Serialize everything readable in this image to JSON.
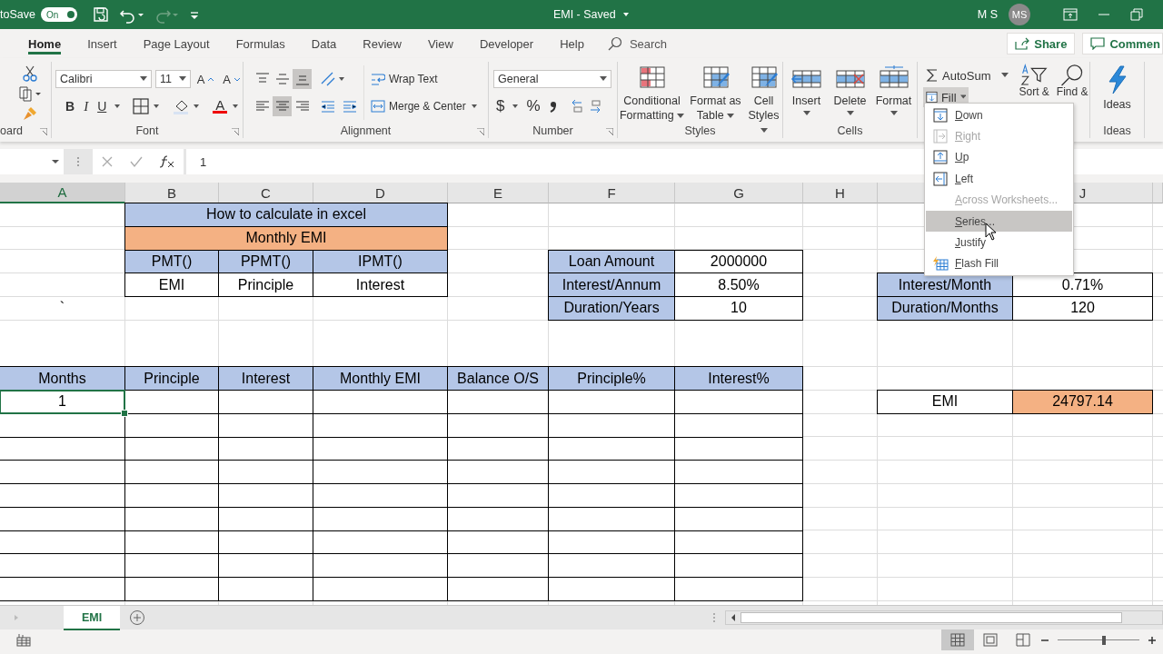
{
  "title_bar": {
    "autosave_label": "toSave",
    "autosave_toggle": {
      "label": "On",
      "on": true
    },
    "document_title": "EMI  -  Saved",
    "user_name": "M S",
    "avatar_initials": "MS"
  },
  "tabs": [
    {
      "label": "Home",
      "selected": true
    },
    {
      "label": "Insert",
      "selected": false
    },
    {
      "label": "Page Layout",
      "selected": false
    },
    {
      "label": "Formulas",
      "selected": false
    },
    {
      "label": "Data",
      "selected": false
    },
    {
      "label": "Review",
      "selected": false
    },
    {
      "label": "View",
      "selected": false
    },
    {
      "label": "Developer",
      "selected": false
    },
    {
      "label": "Help",
      "selected": false
    }
  ],
  "search": {
    "placeholder": "Search"
  },
  "share_button": "Share",
  "comments_button": "Commen",
  "ribbon": {
    "clipboard": {
      "label": "oard"
    },
    "font": {
      "font_name": "Calibri",
      "font_size": "11",
      "grow_glyph": "A",
      "shrink_glyph": "A",
      "bold": "B",
      "italic": "I",
      "underline": "U",
      "color_glyph": "A",
      "label": "Font"
    },
    "alignment": {
      "vertical_buttons": [
        {
          "kind": "top",
          "selected": false
        },
        {
          "kind": "middle",
          "selected": false
        },
        {
          "kind": "bottom",
          "selected": true
        }
      ],
      "horizontal_buttons": [
        {
          "kind": "left",
          "selected": false
        },
        {
          "kind": "center",
          "selected": true
        },
        {
          "kind": "right",
          "selected": false
        }
      ],
      "wrap_text": "Wrap Text",
      "merge_center": "Merge & Center",
      "label": "Alignment"
    },
    "number": {
      "format": "General",
      "currency": "$",
      "percent": "%",
      "label": "Number"
    },
    "styles": {
      "buttons": [
        {
          "kind": "conditional",
          "label": "Conditional Formatting"
        },
        {
          "kind": "table",
          "label": "Format as Table"
        },
        {
          "kind": "cellstyles",
          "label": "Cell Styles"
        }
      ],
      "label": "Styles"
    },
    "cells": {
      "buttons": [
        {
          "kind": "insert",
          "label": "Insert"
        },
        {
          "kind": "delete",
          "label": "Delete"
        },
        {
          "kind": "format",
          "label": "Format"
        }
      ],
      "label": "Cells"
    },
    "editing": {
      "autosum": "AutoSum",
      "fill": "Fill",
      "sort": "Sort &",
      "find": "Find &"
    },
    "ideas": {
      "button": "Ideas",
      "label": "Ideas"
    }
  },
  "formula_bar": {
    "value": "1"
  },
  "sheet": {
    "columns": [
      {
        "label": "A",
        "selected": true
      },
      {
        "label": "B",
        "selected": false
      },
      {
        "label": "C",
        "selected": false
      },
      {
        "label": "D",
        "selected": false
      },
      {
        "label": "E",
        "selected": false
      },
      {
        "label": "F",
        "selected": false
      },
      {
        "label": "G",
        "selected": false
      },
      {
        "label": "H",
        "selected": false
      },
      {
        "selected": false
      },
      {
        "label": "J",
        "selected": false
      }
    ],
    "rows": [
      [
        {},
        {
          "text": "How to calculate in excel",
          "color": "#b4c6e7",
          "bordered": true
        },
        {
          "merged": true
        },
        {
          "merged": true
        }
      ],
      [
        {},
        {
          "text": "Monthly EMI",
          "color": "#f4b183",
          "bordered": true
        },
        {
          "merged": true
        },
        {
          "merged": true
        }
      ],
      [
        {},
        {
          "text": "PMT()",
          "color": "#b4c6e7",
          "bordered": true
        },
        {
          "text": "PPMT()",
          "color": "#b4c6e7",
          "bordered": true
        },
        {
          "text": "IPMT()",
          "color": "#b4c6e7",
          "bordered": true
        },
        {},
        {
          "text": "Loan Amount",
          "color": "#b4c6e7",
          "bordered": true
        },
        {
          "text": "2000000",
          "bordered": true
        }
      ],
      [
        {},
        {
          "text": "EMI",
          "bordered": true
        },
        {
          "text": "Principle",
          "bordered": true
        },
        {
          "text": "Interest",
          "bordered": true
        },
        {},
        {
          "text": "Interest/Annum",
          "color": "#b4c6e7",
          "bordered": true
        },
        {
          "text": "8.50%",
          "bordered": true
        },
        {},
        {
          "text": "Interest/Month",
          "color": "#b4c6e7",
          "bordered": true
        },
        {
          "text": "0.71%",
          "bordered": true
        }
      ],
      [
        {
          "text": "`"
        },
        {},
        {},
        {},
        {},
        {
          "text": "Duration/Years",
          "color": "#b4c6e7",
          "bordered": true
        },
        {
          "text": "10",
          "bordered": true
        },
        {},
        {
          "text": "Duration/Months",
          "color": "#b4c6e7",
          "bordered": true
        },
        {
          "text": "120",
          "bordered": true
        }
      ],
      [],
      [],
      [
        {
          "text": "Months",
          "color": "#b4c6e7",
          "bordered": true
        },
        {
          "text": "Principle",
          "color": "#b4c6e7",
          "bordered": true
        },
        {
          "text": "Interest",
          "color": "#b4c6e7",
          "bordered": true
        },
        {
          "text": "Monthly EMI",
          "color": "#b4c6e7",
          "bordered": true
        },
        {
          "text": "Balance O/S",
          "color": "#b4c6e7",
          "bordered": true
        },
        {
          "text": "Principle%",
          "color": "#b4c6e7",
          "bordered": true
        },
        {
          "text": "Interest%",
          "color": "#b4c6e7",
          "bordered": true
        }
      ],
      [
        {
          "text": "1",
          "bordered": true,
          "active": true
        },
        {
          "bordered": true
        },
        {
          "bordered": true
        },
        {
          "bordered": true
        },
        {
          "bordered": true
        },
        {
          "bordered": true
        },
        {
          "bordered": true
        },
        {},
        {
          "text": "EMI",
          "bordered": true
        },
        {
          "text": "24797.14",
          "color": "#f4b183",
          "bordered": true
        }
      ],
      [
        {
          "bordered": true
        },
        {
          "bordered": true
        },
        {
          "bordered": true
        },
        {
          "bordered": true
        },
        {
          "bordered": true
        },
        {
          "bordered": true
        },
        {
          "bordered": true
        }
      ],
      [
        {
          "bordered": true
        },
        {
          "bordered": true
        },
        {
          "bordered": true
        },
        {
          "bordered": true
        },
        {
          "bordered": true
        },
        {
          "bordered": true
        },
        {
          "bordered": true
        }
      ],
      [
        {
          "bordered": true
        },
        {
          "bordered": true
        },
        {
          "bordered": true
        },
        {
          "bordered": true
        },
        {
          "bordered": true
        },
        {
          "bordered": true
        },
        {
          "bordered": true
        }
      ],
      [
        {
          "bordered": true
        },
        {
          "bordered": true
        },
        {
          "bordered": true
        },
        {
          "bordered": true
        },
        {
          "bordered": true
        },
        {
          "bordered": true
        },
        {
          "bordered": true
        }
      ],
      [
        {
          "bordered": true
        },
        {
          "bordered": true
        },
        {
          "bordered": true
        },
        {
          "bordered": true
        },
        {
          "bordered": true
        },
        {
          "bordered": true
        },
        {
          "bordered": true
        }
      ],
      [
        {
          "bordered": true
        },
        {
          "bordered": true
        },
        {
          "bordered": true
        },
        {
          "bordered": true
        },
        {
          "bordered": true
        },
        {
          "bordered": true
        },
        {
          "bordered": true
        }
      ],
      [
        {
          "bordered": true
        },
        {
          "bordered": true
        },
        {
          "bordered": true
        },
        {
          "bordered": true
        },
        {
          "bordered": true
        },
        {
          "bordered": true
        },
        {
          "bordered": true
        }
      ],
      [
        {
          "bordered": true
        },
        {
          "bordered": true
        },
        {
          "bordered": true
        },
        {
          "bordered": true
        },
        {
          "bordered": true
        },
        {
          "bordered": true
        },
        {
          "bordered": true
        }
      ]
    ]
  },
  "fill_menu": {
    "items": [
      {
        "kind": "down",
        "label": "Down",
        "disabled": false,
        "selected": false
      },
      {
        "kind": "right",
        "label": "Right",
        "disabled": true,
        "selected": false
      },
      {
        "kind": "up",
        "label": "Up",
        "disabled": false,
        "selected": false
      },
      {
        "kind": "left",
        "label": "Left",
        "disabled": false,
        "selected": false
      },
      {
        "kind": "across",
        "label": "Across Worksheets...",
        "disabled": true,
        "selected": false
      },
      {
        "kind": "series",
        "label": "Series...",
        "disabled": false,
        "selected": true
      },
      {
        "kind": "justify",
        "label": "Justify",
        "disabled": false,
        "selected": false
      },
      {
        "kind": "flash",
        "label": "Flash Fill",
        "disabled": false,
        "selected": false
      }
    ]
  },
  "sheet_tabs": [
    {
      "label": "EMI",
      "selected": true
    }
  ],
  "zoom_slider": {
    "level": 0.57
  }
}
